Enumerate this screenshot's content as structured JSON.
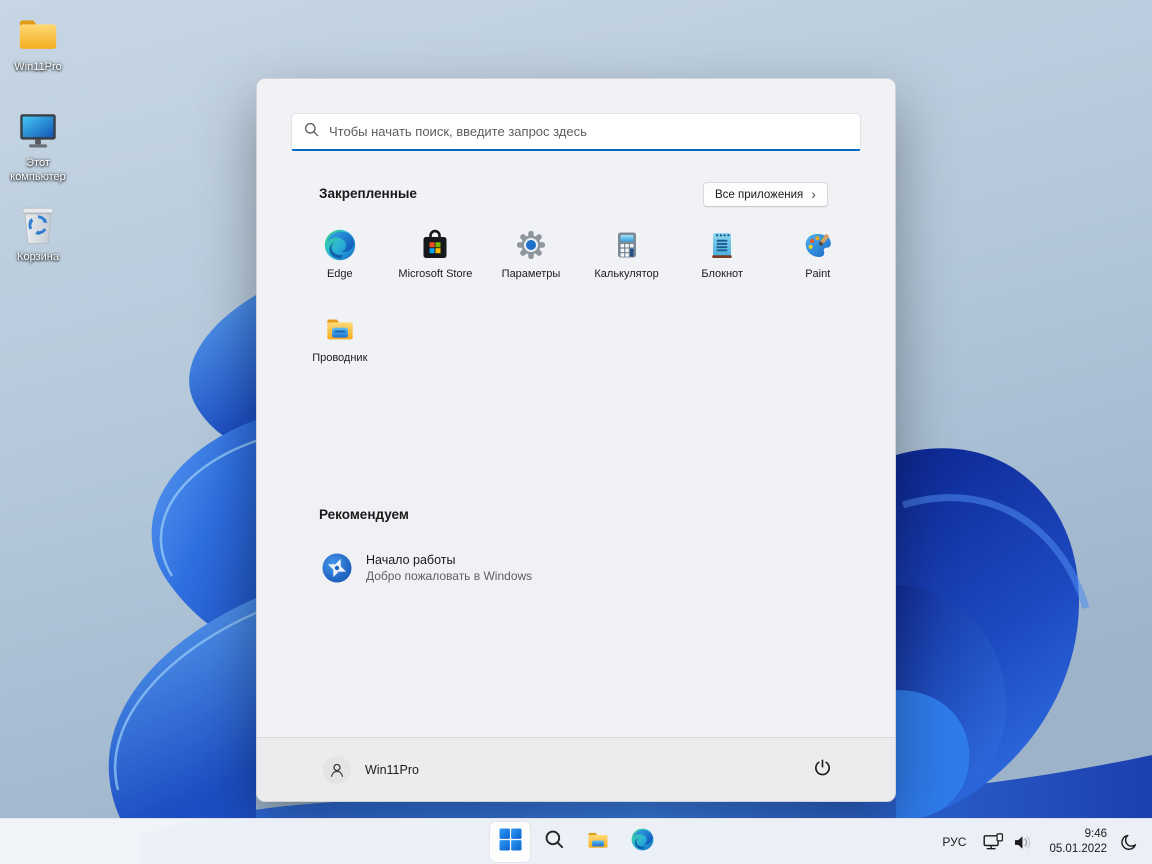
{
  "desktop": {
    "icons": [
      {
        "label": "Win11Pro",
        "icon": "folder-icon"
      },
      {
        "label": "Этот компьютер",
        "icon": "this-pc-icon"
      },
      {
        "label": "Корзина",
        "icon": "recycle-bin-icon"
      }
    ]
  },
  "start_menu": {
    "search_placeholder": "Чтобы начать поиск, введите запрос здесь",
    "pinned_title": "Закрепленные",
    "all_apps_button": "Все приложения",
    "all_apps_chevron": "›",
    "pinned_apps": [
      {
        "label": "Edge",
        "icon": "edge-icon"
      },
      {
        "label": "Microsoft Store",
        "icon": "microsoft-store-icon"
      },
      {
        "label": "Параметры",
        "icon": "settings-gear-icon"
      },
      {
        "label": "Калькулятор",
        "icon": "calculator-icon"
      },
      {
        "label": "Блокнот",
        "icon": "notepad-icon"
      },
      {
        "label": "Paint",
        "icon": "paint-palette-icon"
      },
      {
        "label": "Проводник",
        "icon": "file-explorer-folder-icon"
      }
    ],
    "recommended_title": "Рекомендуем",
    "recommended": [
      {
        "title": "Начало работы",
        "subtitle": "Добро пожаловать в Windows",
        "icon": "get-started-icon"
      }
    ],
    "user_name": "Win11Pro"
  },
  "taskbar": {
    "language": "РУС",
    "time": "9:46",
    "date": "05.01.2022"
  },
  "colors": {
    "accent": "#0067c0",
    "menu_background": "#f2f3f6",
    "taskbar_background": "#f3f5f8"
  }
}
